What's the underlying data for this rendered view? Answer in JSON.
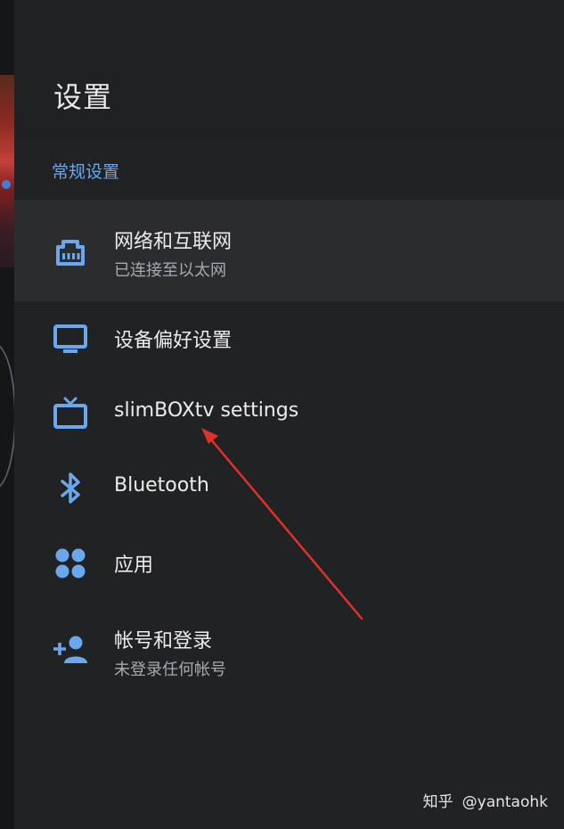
{
  "settings": {
    "title": "设置",
    "section_label": "常规设置",
    "items": [
      {
        "title": "网络和互联网",
        "subtitle": "已连接至以太网",
        "icon": "ethernet-icon",
        "selected": true
      },
      {
        "title": "设备偏好设置",
        "subtitle": "",
        "icon": "monitor-icon",
        "selected": false
      },
      {
        "title": "slimBOXtv settings",
        "subtitle": "",
        "icon": "tv-icon",
        "selected": false
      },
      {
        "title": "Bluetooth",
        "subtitle": "",
        "icon": "bluetooth-icon",
        "selected": false
      },
      {
        "title": "应用",
        "subtitle": "",
        "icon": "apps-icon",
        "selected": false
      },
      {
        "title": "帐号和登录",
        "subtitle": "未登录任何帐号",
        "icon": "add-person-icon",
        "selected": false
      }
    ]
  },
  "annotation": {
    "arrow_color": "#e0302a"
  },
  "watermark": {
    "brand": "知乎",
    "handle": "@yantaohk"
  },
  "colors": {
    "accent": "#6aa7ee",
    "panel_bg": "#212224",
    "selected_row_bg": "#2b2c2e"
  }
}
